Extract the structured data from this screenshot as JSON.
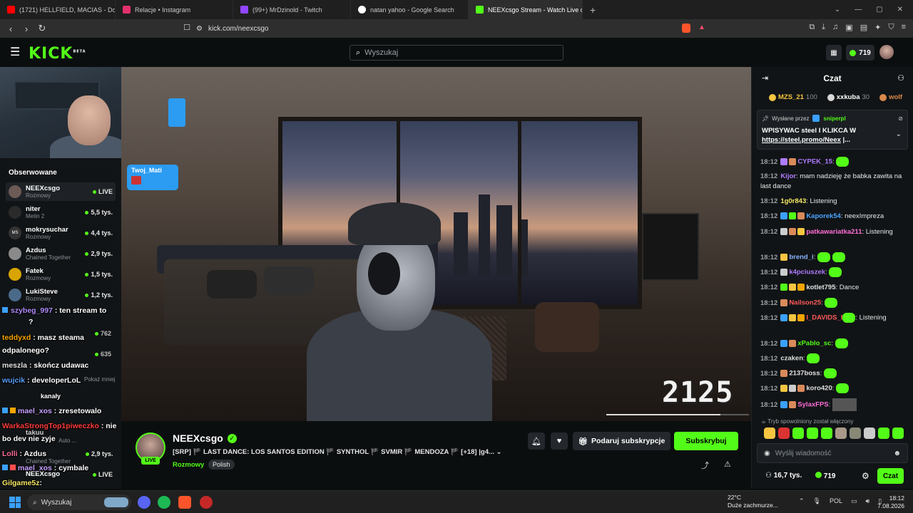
{
  "browser": {
    "tabs": [
      {
        "title": "(1721) HELLFIELD, MACIAS - Domini",
        "color": "#ff0000"
      },
      {
        "title": "Relacje • Instagram",
        "color": "#e1306c"
      },
      {
        "title": "(99+) MrDzinold - Twitch",
        "color": "#9146ff"
      },
      {
        "title": "natan yahoo - Google Search",
        "color": "#ffffff"
      },
      {
        "title": "NEEXcsgo Stream - Watch Live o",
        "color": "#53fc18"
      }
    ],
    "url": "kick.com/neexcsgo"
  },
  "header": {
    "logo": "KICK",
    "logo_beta": "BETA",
    "search_placeholder": "Wyszukaj",
    "coins": "719"
  },
  "sidebar": {
    "followed_title": "Obserwowane",
    "items": [
      {
        "name": "NEEXcsgo",
        "category": "Rozmowy",
        "viewers": "LIVE",
        "avatar": ""
      },
      {
        "name": "niter",
        "category": "Metin 2",
        "viewers": "5,5 tys.",
        "avatar": ""
      },
      {
        "name": "mokrysuchar",
        "category": "Rozmowy",
        "viewers": "4,4 tys.",
        "avatar": "MS"
      },
      {
        "name": "Azdus",
        "category": "Chained Together",
        "viewers": "2,9 tys.",
        "avatar": ""
      },
      {
        "name": "Fatek",
        "category": "Rozmowy",
        "viewers": "1,5 tys.",
        "avatar": ""
      },
      {
        "name": "LukiSteve",
        "category": "Rozmowy",
        "viewers": "1,2 tys.",
        "avatar": ""
      }
    ],
    "hidden_viewers": [
      "762",
      "635"
    ],
    "hidden_partial": "Pokaż mniej",
    "hidden_channels": "kanały",
    "hidden_lower": [
      {
        "name": "takuu",
        "category": "Auto ...",
        "viewers": ""
      },
      {
        "name": "Azdus",
        "category": "Chained Together",
        "viewers": "2,9 tys."
      },
      {
        "name": "NEEXcsgo",
        "category": "",
        "viewers": "LIVE"
      }
    ]
  },
  "overlay_chat": [
    {
      "user": "szybeg_997",
      "text": ": ten stream to",
      "color": "#b08cff"
    },
    {
      "user": "",
      "text": "?",
      "color": "#ffffff"
    },
    {
      "user": "teddyxd",
      "text": ": masz steama",
      "color": "#f7a500"
    },
    {
      "user": "",
      "text": "odpalonego?",
      "color": "#ffffff"
    },
    {
      "user": "meszla",
      "text": ": skończ udawac",
      "color": "#e0e0e0"
    },
    {
      "user": "wujcik",
      "text": ": developerLoL",
      "color": "#5aa0ff"
    },
    {
      "user": "",
      "text": "kanały",
      "color": "#ffffff"
    },
    {
      "user": "mael_xos",
      "text": ": zresetowalo",
      "color": "#c7a0ff"
    },
    {
      "user": "WarkaStrongTop1piweczko",
      "text": ": nie",
      "color": "#ff3b3b"
    },
    {
      "user": "",
      "text": "bo dev nie zyje",
      "color": "#ffffff"
    },
    {
      "user": "Lolli",
      "text": ": Azdus",
      "color": "#ff6f9a"
    },
    {
      "user": "mael_xos",
      "text": ": cymbale",
      "color": "#c7a0ff"
    },
    {
      "user": "Gilgame5z",
      "text": ":",
      "color": "#f5e663"
    }
  ],
  "video": {
    "donor_name": "Twoj_Mati",
    "counter": "2125"
  },
  "stream": {
    "channel": "NEEXcsgo",
    "live": "LIVE",
    "title": "[SRP] 🏴 LAST DANCE: LOS SANTOS EDITION 🏴 SYNTHOL 🏴 SVMIR 🏴 MENDOZA 🏴 [+18] |g4...",
    "category": "Rozmowy",
    "tag": "Polish",
    "gift_label": "Podaruj subskrypcje",
    "subscribe_label": "Subskrybuj"
  },
  "chat": {
    "title": "Czat",
    "leaderboard": [
      {
        "name": "MZS_21",
        "points": "100",
        "color": "#f5c542"
      },
      {
        "name": "xxkuba",
        "points": "30",
        "color": "#d9d9d9"
      },
      {
        "name": "wolf",
        "points": "",
        "color": "#d9884a"
      }
    ],
    "pinned_by_label": "Wysłane przez",
    "pinned_by_user": "sniperpl",
    "pinned_line1": "WPISYWAC steel I KLIKCA W",
    "pinned_link": "https://steel.promo/Neex",
    "pinned_more": "|...",
    "messages": [
      {
        "time": "18:12",
        "user": "CYPEK_15",
        "text": ":",
        "color": "#b07cff",
        "emote": true
      },
      {
        "time": "18:12",
        "user": "Kijor",
        "text": ": mam nadzieję że babka zawita na last dance",
        "color": "#b07cff",
        "emote": false
      },
      {
        "time": "18:12",
        "user": "1g0r843",
        "text": ": Listening",
        "color": "#f5e663",
        "emote": false
      },
      {
        "time": "18:12",
        "user": "Kaporek54",
        "text": ": neexImpreza",
        "color": "#4aa3ff",
        "emote": false
      },
      {
        "time": "18:12",
        "user": "patkawariatka211",
        "text": ": Listening",
        "color": "#ff6fd8",
        "emote": false
      },
      {
        "time": "18:12",
        "user": "brend_i",
        "text": ":",
        "color": "#8ab4ff",
        "emote": true
      },
      {
        "time": "18:12",
        "user": "k4pciuszek",
        "text": ":",
        "color": "#b07cff",
        "emote": true
      },
      {
        "time": "18:12",
        "user": "kotlet795",
        "text": ": Dance",
        "color": "#e0e0e0",
        "emote": false
      },
      {
        "time": "18:12",
        "user": "Nailson25",
        "text": ":",
        "color": "#ff5a5a",
        "emote": true
      },
      {
        "time": "18:12",
        "user": "I_DAVIDS_I",
        "text": ": Listening",
        "color": "#ff5a5a",
        "emote": true
      },
      {
        "time": "18:12",
        "user": "xPablo_sc",
        "text": ":",
        "color": "#53fc18",
        "emote": true
      },
      {
        "time": "18:12",
        "user": "czaken",
        "text": ":",
        "color": "#e0e0e0",
        "emote": true
      },
      {
        "time": "18:12",
        "user": "2137boss",
        "text": ":",
        "color": "#e0e0e0",
        "emote": true
      },
      {
        "time": "18:12",
        "user": "koro420",
        "text": ":",
        "color": "#e0e0e0",
        "emote": true
      },
      {
        "time": "18:12",
        "user": "SylaxFPS",
        "text": ":",
        "color": "#ff6fd8",
        "emote": true
      }
    ],
    "slow_mode": "Tryb spowolniony został włączony",
    "input_placeholder": "Wyślij wiadomość",
    "viewers": "16,7 tys.",
    "coins": "719",
    "send_label": "Czat"
  },
  "taskbar": {
    "search": "Wyszukaj",
    "weather_temp": "22°C",
    "weather_desc": "Duże zachmurze...",
    "lang": "POL",
    "time": "18:12",
    "date": "7.08.2026"
  }
}
